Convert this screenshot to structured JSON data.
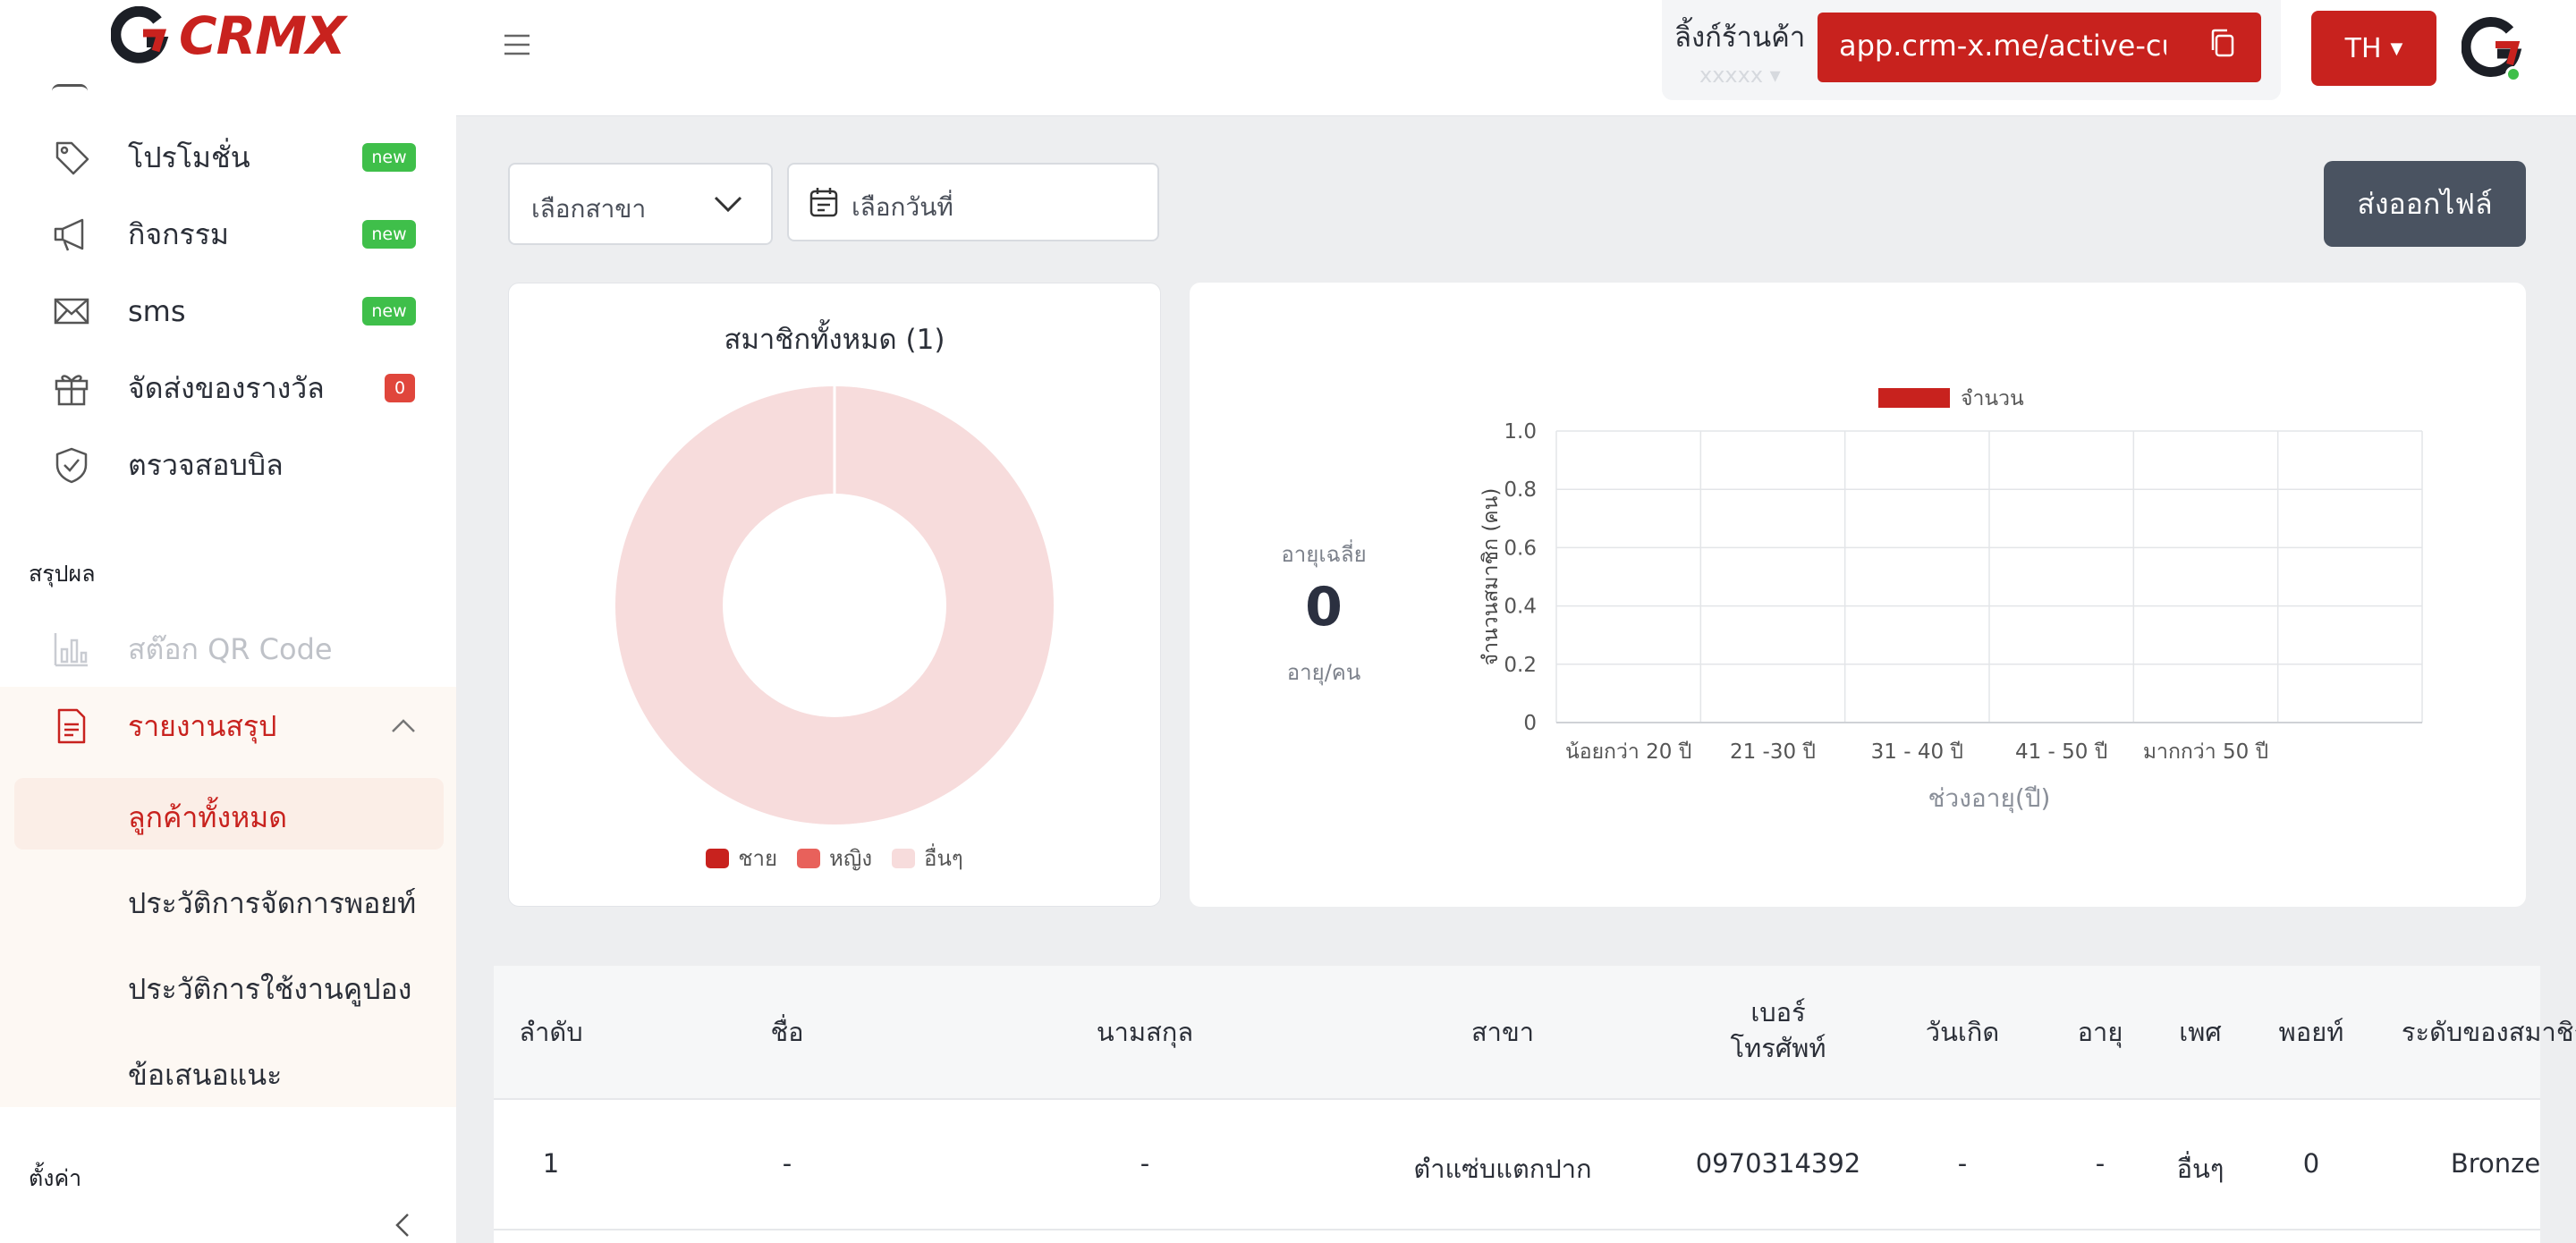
{
  "app": {
    "logo_text": "CRMX"
  },
  "sidebar": {
    "items": [
      {
        "label": "โปรโมชั่น",
        "badge": "new",
        "icon": "tag-icon"
      },
      {
        "label": "กิจกรรม",
        "badge": "new",
        "icon": "megaphone-icon"
      },
      {
        "label": "sms",
        "badge": "new",
        "icon": "envelope-icon"
      },
      {
        "label": "จัดส่งของรางวัล",
        "badge": "0",
        "icon": "gift-icon"
      },
      {
        "label": "ตรวจสอบบิล",
        "badge": "",
        "icon": "shield-check-icon"
      }
    ],
    "section_summary": "สรุปผล",
    "qr_stock": "สต๊อก QR Code",
    "report": "รายงานสรุป",
    "submenu": [
      "ลูกค้าทั้งหมด",
      "ประวัติการจัดการพอยท์",
      "ประวัติการใช้งานคูปอง",
      "ข้อเสนอแนะ"
    ],
    "section_settings": "ตั้งค่า"
  },
  "topbar": {
    "shop_label": "ลิ้งก์ร้านค้า",
    "shop_sub": "xxxxx",
    "shop_link": "app.crm-x.me/active-customers",
    "language": "TH"
  },
  "filters": {
    "branch_placeholder": "เลือกสาขา",
    "date_placeholder": "เลือกวันที่",
    "export_label": "ส่งออกไฟล์"
  },
  "colors": {
    "brand": "#c8221e",
    "male": "#c8221e",
    "female": "#e8615b",
    "other": "#f7dcdc",
    "new_badge": "#3fbf4a"
  },
  "age_summary": {
    "label": "อายุเฉลี่ย",
    "value": "0",
    "unit": "อายุ/คน"
  },
  "chart_data": [
    {
      "type": "pie",
      "title": "สมาชิกทั้งหมด (1)",
      "categories": [
        "ชาย",
        "หญิง",
        "อื่นๆ"
      ],
      "values": [
        0,
        0,
        1
      ],
      "donut": true
    },
    {
      "type": "bar",
      "categories": [
        "น้อยกว่า 20 ปี",
        "21 -30 ปี",
        "31 - 40 ปี",
        "41 - 50 ปี",
        "มากกว่า 50 ปี"
      ],
      "series": [
        {
          "name": "จำนวน",
          "values": [
            0,
            0,
            0,
            0,
            0
          ]
        }
      ],
      "xlabel": "ช่วงอายุ(ปี)",
      "ylabel": "จำนวนสมาชิก (คน)",
      "ylim": [
        0,
        1
      ],
      "yticks": [
        "0",
        "0.2",
        "0.4",
        "0.6",
        "0.8",
        "1.0"
      ],
      "grid": true,
      "legend": "top"
    }
  ],
  "table": {
    "headers": [
      "ลำดับ",
      "ชื่อ",
      "นามสกุล",
      "สาขา",
      "เบอร์\nโทรศัพท์",
      "วันเกิด",
      "อายุ",
      "เพศ",
      "พอยท์",
      "ระดับของสมาชิก"
    ],
    "rows": [
      [
        "1",
        "-",
        "-",
        "ตำแซ่บแตกปาก",
        "0970314392",
        "-",
        "-",
        "อื่นๆ",
        "0",
        "Bronze"
      ]
    ]
  }
}
